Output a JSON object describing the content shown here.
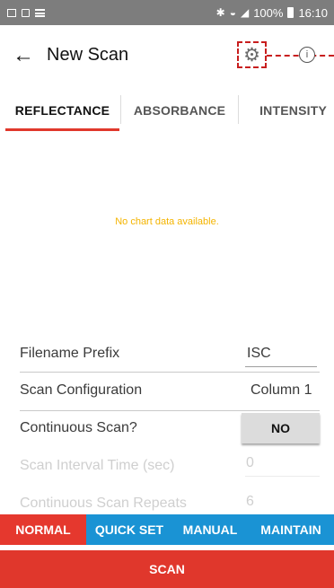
{
  "status_bar": {
    "battery": "100%",
    "time": "16:10",
    "icons": [
      "image-icon",
      "cast-icon",
      "list-icon",
      "bluetooth-icon",
      "wifi-icon",
      "signal-icon"
    ]
  },
  "app_bar": {
    "title": "New Scan",
    "back_icon": "arrow-left-icon",
    "settings_icon": "gear-icon",
    "info_icon": "info-icon",
    "info_glyph": "i"
  },
  "tabs": [
    {
      "label": "REFLECTANCE",
      "active": true
    },
    {
      "label": "ABSORBANCE",
      "active": false
    },
    {
      "label": "INTENSITY",
      "active": false
    }
  ],
  "chart": {
    "empty_message": "No chart data available."
  },
  "form": {
    "filename_prefix": {
      "label": "Filename Prefix",
      "value": "ISC"
    },
    "scan_configuration": {
      "label": "Scan Configuration",
      "value": "Column 1"
    },
    "continuous_scan": {
      "label": "Continuous Scan?",
      "value": "NO"
    },
    "scan_interval": {
      "label": "Scan Interval Time (sec)",
      "value": "0",
      "enabled": false
    },
    "scan_repeats": {
      "label": "Continuous Scan Repeats",
      "value": "6",
      "enabled": false
    }
  },
  "bottom_nav": [
    {
      "label": "NORMAL",
      "active": true
    },
    {
      "label": "QUICK SET",
      "active": false
    },
    {
      "label": "MANUAL",
      "active": false
    },
    {
      "label": "MAINTAIN",
      "active": false
    }
  ],
  "scan_button": {
    "label": "SCAN"
  },
  "colors": {
    "accent_red": "#e0372c",
    "nav_blue": "#1a93d4",
    "annotation_red": "#c81e1e",
    "empty_text": "#f4b400"
  }
}
